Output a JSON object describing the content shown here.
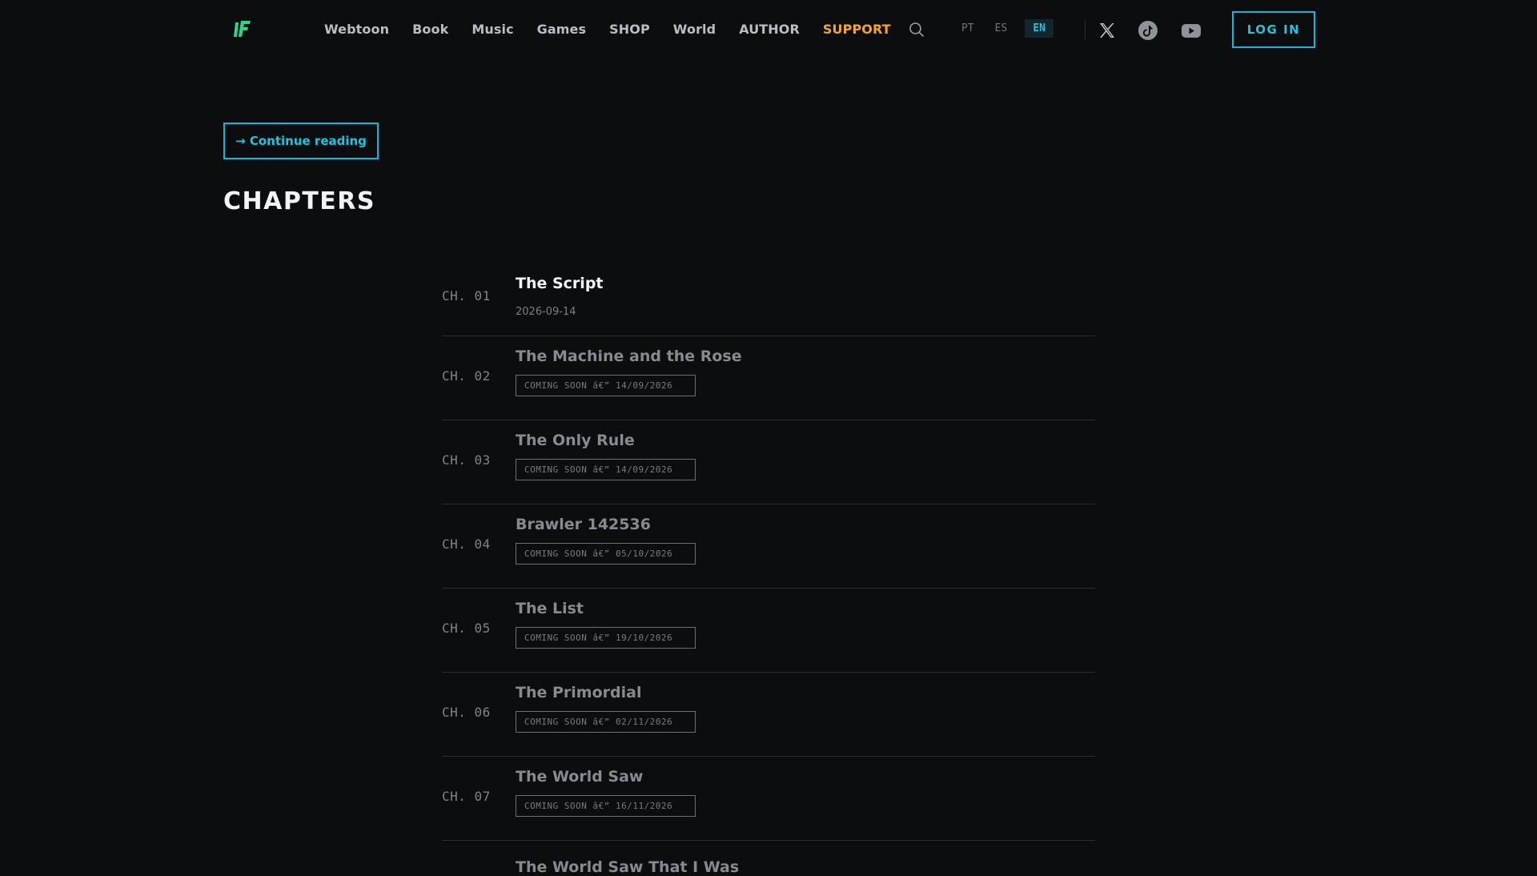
{
  "header": {
    "logo_text": "IF",
    "nav": [
      "Webtoon",
      "Book",
      "Music",
      "Games",
      "SHOP",
      "World",
      "AUTHOR",
      "SUPPORT"
    ],
    "languages": [
      "PT",
      "ES",
      "EN"
    ],
    "active_language": "EN",
    "social_icons": [
      "x-icon",
      "tiktok-icon",
      "youtube-icon"
    ],
    "login_label": "LOG IN"
  },
  "content": {
    "continue_label": "→ Continue reading",
    "section_title": "CHAPTERS"
  },
  "chapters": [
    {
      "num": "CH. 01",
      "title": "The Script",
      "date": "2026-09-14",
      "status": "released"
    },
    {
      "num": "CH. 02",
      "title": "The Machine and the Rose",
      "badge": "COMING SOON â€” 14/09/2026",
      "status": "coming"
    },
    {
      "num": "CH. 03",
      "title": "The Only Rule",
      "badge": "COMING SOON â€” 14/09/2026",
      "status": "coming"
    },
    {
      "num": "CH. 04",
      "title": "Brawler 142536",
      "badge": "COMING SOON â€” 05/10/2026",
      "status": "coming"
    },
    {
      "num": "CH. 05",
      "title": "The List",
      "badge": "COMING SOON â€” 19/10/2026",
      "status": "coming"
    },
    {
      "num": "CH. 06",
      "title": "The Primordial",
      "badge": "COMING SOON â€” 02/11/2026",
      "status": "coming"
    },
    {
      "num": "CH. 07",
      "title": "The World Saw",
      "badge": "COMING SOON â€” 16/11/2026",
      "status": "coming"
    },
    {
      "num": "",
      "title": "The World Saw That I Was",
      "status": "partial"
    }
  ],
  "colors": {
    "background": "#0b0d0f",
    "accent": "#1ec4e0",
    "support": "#f5a623",
    "logo": "#2ed48a"
  }
}
